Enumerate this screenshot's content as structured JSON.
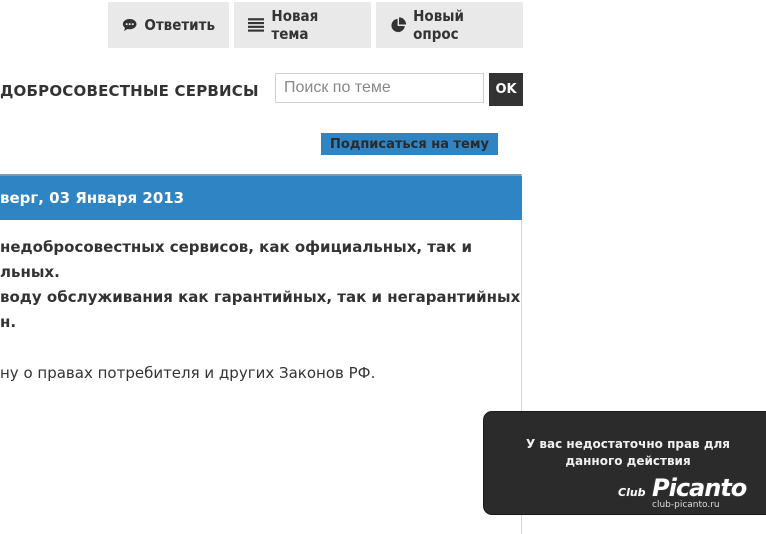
{
  "toolbar": {
    "reply_label": "Ответить",
    "new_topic_label": "Новая тема",
    "new_poll_label": "Новый опрос"
  },
  "topic": {
    "title": "ДОБРОСОВЕСТНЫЕ СЕРВИСЫ"
  },
  "search": {
    "placeholder": "Поиск по теме",
    "button_label": "OK"
  },
  "subscribe_label": "Подписаться на тему",
  "post": {
    "date_header": "верг, 03 Января 2013",
    "lines": [
      "недобросовестных сервисов, как официальных, так и",
      "льных.",
      "воду обслуживания как гарантийных, так и негарантийных",
      "н.",
      "ну о правах потребителя и других Законов РФ."
    ]
  },
  "toast": {
    "message": "У вас недостаточно прав для данного действия"
  },
  "logo": {
    "club": "Club",
    "brand": "Picanto",
    "url": "club-picanto.ru"
  },
  "colors": {
    "accent": "#2f84c4",
    "button_bg": "#e9e9e9",
    "dark": "#333333",
    "toast_bg": "#2b2b2b"
  }
}
